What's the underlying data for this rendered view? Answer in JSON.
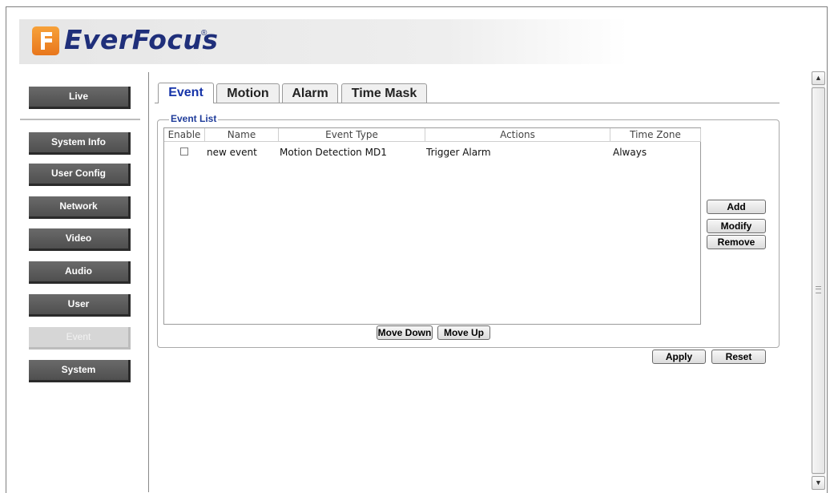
{
  "brand": {
    "name": "EverFocus",
    "reg_mark": "®"
  },
  "sidebar": {
    "items": [
      {
        "label": "Live"
      },
      {
        "label": "System Info"
      },
      {
        "label": "User Config"
      },
      {
        "label": "Network"
      },
      {
        "label": "Video"
      },
      {
        "label": "Audio"
      },
      {
        "label": "User"
      },
      {
        "label": "Event",
        "active": true
      },
      {
        "label": "System"
      }
    ]
  },
  "tabs": [
    {
      "label": "Event",
      "active": true
    },
    {
      "label": "Motion"
    },
    {
      "label": "Alarm"
    },
    {
      "label": "Time Mask"
    }
  ],
  "event_list": {
    "legend": "Event List",
    "columns": [
      "Enable",
      "Name",
      "Event Type",
      "Actions",
      "Time Zone"
    ],
    "rows": [
      {
        "enabled": false,
        "name": "new event",
        "event_type": "Motion Detection MD1",
        "actions": "Trigger Alarm",
        "time_zone": "Always"
      }
    ],
    "buttons": {
      "add": "Add",
      "modify": "Modify",
      "remove": "Remove",
      "move_down": "Move Down",
      "move_up": "Move Up"
    }
  },
  "footer_buttons": {
    "apply": "Apply",
    "reset": "Reset"
  },
  "scrollbar": {
    "up_icon": "chevron-up-icon",
    "down_icon": "chevron-down-icon"
  },
  "colors": {
    "tab_active": "#1533a8",
    "legend": "#1f3c9a",
    "menu_button": "#5a5a5a",
    "logo_orange": "#f08c2a",
    "logo_blue": "#1f2f7a"
  }
}
